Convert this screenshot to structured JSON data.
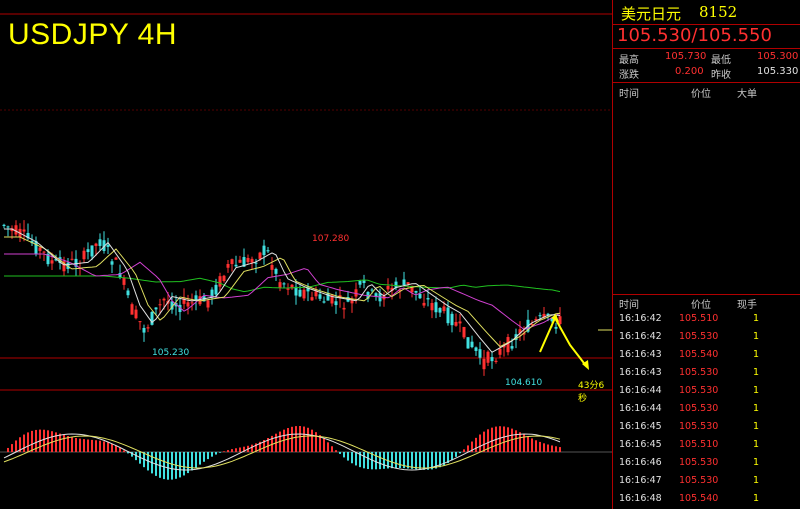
{
  "chart": {
    "title": "USDJPY 4H",
    "annotations": {
      "high_label": "107.280",
      "low_left_label": "105.230",
      "low_right_label": "104.610",
      "countdown": "43分6秒"
    },
    "colors": {
      "up": "#ff3030",
      "down": "#40e0e0",
      "ma_green": "#20c020",
      "ma_magenta": "#d040d0",
      "ma_yellow": "#e0e060",
      "ma_white": "#e0e0e0",
      "grid": "#b00000"
    }
  },
  "panel": {
    "name": "美元日元",
    "code": "8152",
    "quote": "105.530/105.550",
    "stats": {
      "high_label": "最高",
      "high_value": "105.730",
      "low_label": "最低",
      "low_value": "105.300",
      "change_label": "涨跌",
      "change_value": "0.200",
      "prev_label": "昨收",
      "prev_value": "105.330"
    },
    "big_orders_header": {
      "time": "时间",
      "price": "价位",
      "size": "大单"
    },
    "ticks_header": {
      "time": "时间",
      "price": "价位",
      "size": "现手"
    },
    "ticks": [
      {
        "time": "16:16:42",
        "price": "105.510",
        "size": "1"
      },
      {
        "time": "16:16:42",
        "price": "105.530",
        "size": "1"
      },
      {
        "time": "16:16:43",
        "price": "105.540",
        "size": "1"
      },
      {
        "time": "16:16:43",
        "price": "105.530",
        "size": "1"
      },
      {
        "time": "16:16:44",
        "price": "105.530",
        "size": "1"
      },
      {
        "time": "16:16:44",
        "price": "105.530",
        "size": "1"
      },
      {
        "time": "16:16:45",
        "price": "105.530",
        "size": "1"
      },
      {
        "time": "16:16:45",
        "price": "105.510",
        "size": "1"
      },
      {
        "time": "16:16:46",
        "price": "105.530",
        "size": "1"
      },
      {
        "time": "16:16:47",
        "price": "105.530",
        "size": "1"
      },
      {
        "time": "16:16:48",
        "price": "105.540",
        "size": "1"
      }
    ]
  }
}
